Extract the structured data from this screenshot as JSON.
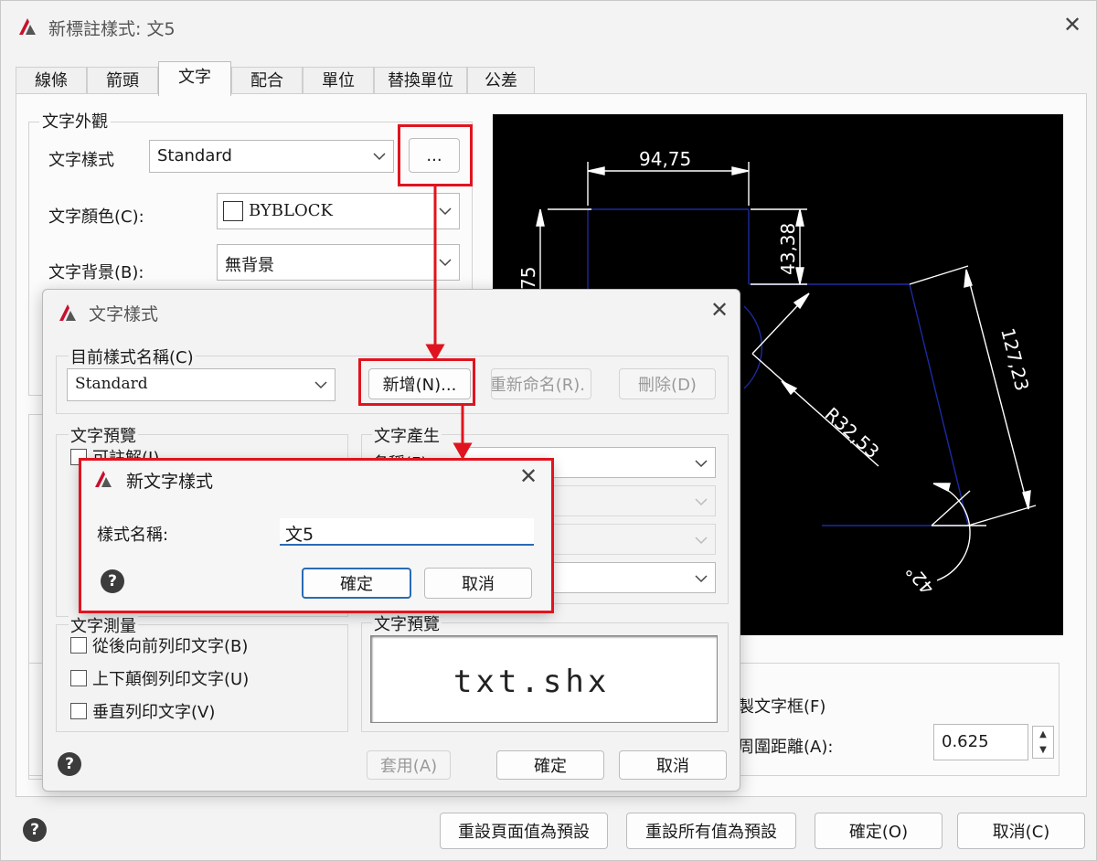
{
  "main": {
    "title": "新標註樣式: 文5",
    "tabs": [
      "線條",
      "箭頭",
      "文字",
      "配合",
      "單位",
      "替換單位",
      "公差"
    ],
    "active_tab": "文字",
    "appearance_group": "文字外觀",
    "text_style_label": "文字樣式",
    "text_style_value": "Standard",
    "browse_button": "...",
    "text_color_label": "文字顏色(C):",
    "text_color_value": "BYBLOCK",
    "fill_label": "文字背景(B):",
    "fill_value": "無背景",
    "frame_label": "製文字框(F)",
    "offset_label": "周圍距離(A):",
    "offset_value": "0.625",
    "reset_page_button": "重設頁面值為預設",
    "reset_all_button": "重設所有值為預設",
    "ok_button": "確定(O)",
    "cancel_button": "取消(C)"
  },
  "preview": {
    "dim_top": "94,75",
    "dim_right": "43,38",
    "dim_left": "75",
    "dim_diag": "127,23",
    "dim_radius": "R32,53",
    "dim_angle": "42°"
  },
  "style_dialog": {
    "title": "文字樣式",
    "current_label": "目前樣式名稱(C)",
    "current_value": "Standard",
    "new_button": "新增(N)...",
    "rename_button": "重新命名(R).",
    "delete_button": "刪除(D)",
    "preview_group": "文字預覽",
    "annotative_label": "可註解(I)",
    "font_group": "文字產生",
    "font_name_label": "名稱(F):",
    "effects_group": "文字測量",
    "backwards_label": "從後向前列印文字(B)",
    "upside_label": "上下顛倒列印文字(U)",
    "vertical_label": "垂直列印文字(V)",
    "preview_area_label": "文字預覽",
    "preview_text": "txt.shx",
    "apply_button": "套用(A)",
    "ok_button": "確定",
    "cancel_button": "取消"
  },
  "new_style_dialog": {
    "title": "新文字樣式",
    "name_label": "樣式名稱:",
    "name_value": "文5",
    "ok_button": "確定",
    "cancel_button": "取消"
  },
  "colors": {
    "highlight": "#e0141e",
    "accent": "#2a6ab5",
    "preview_bg": "#000000",
    "preview_line": "#1d2aa0"
  }
}
